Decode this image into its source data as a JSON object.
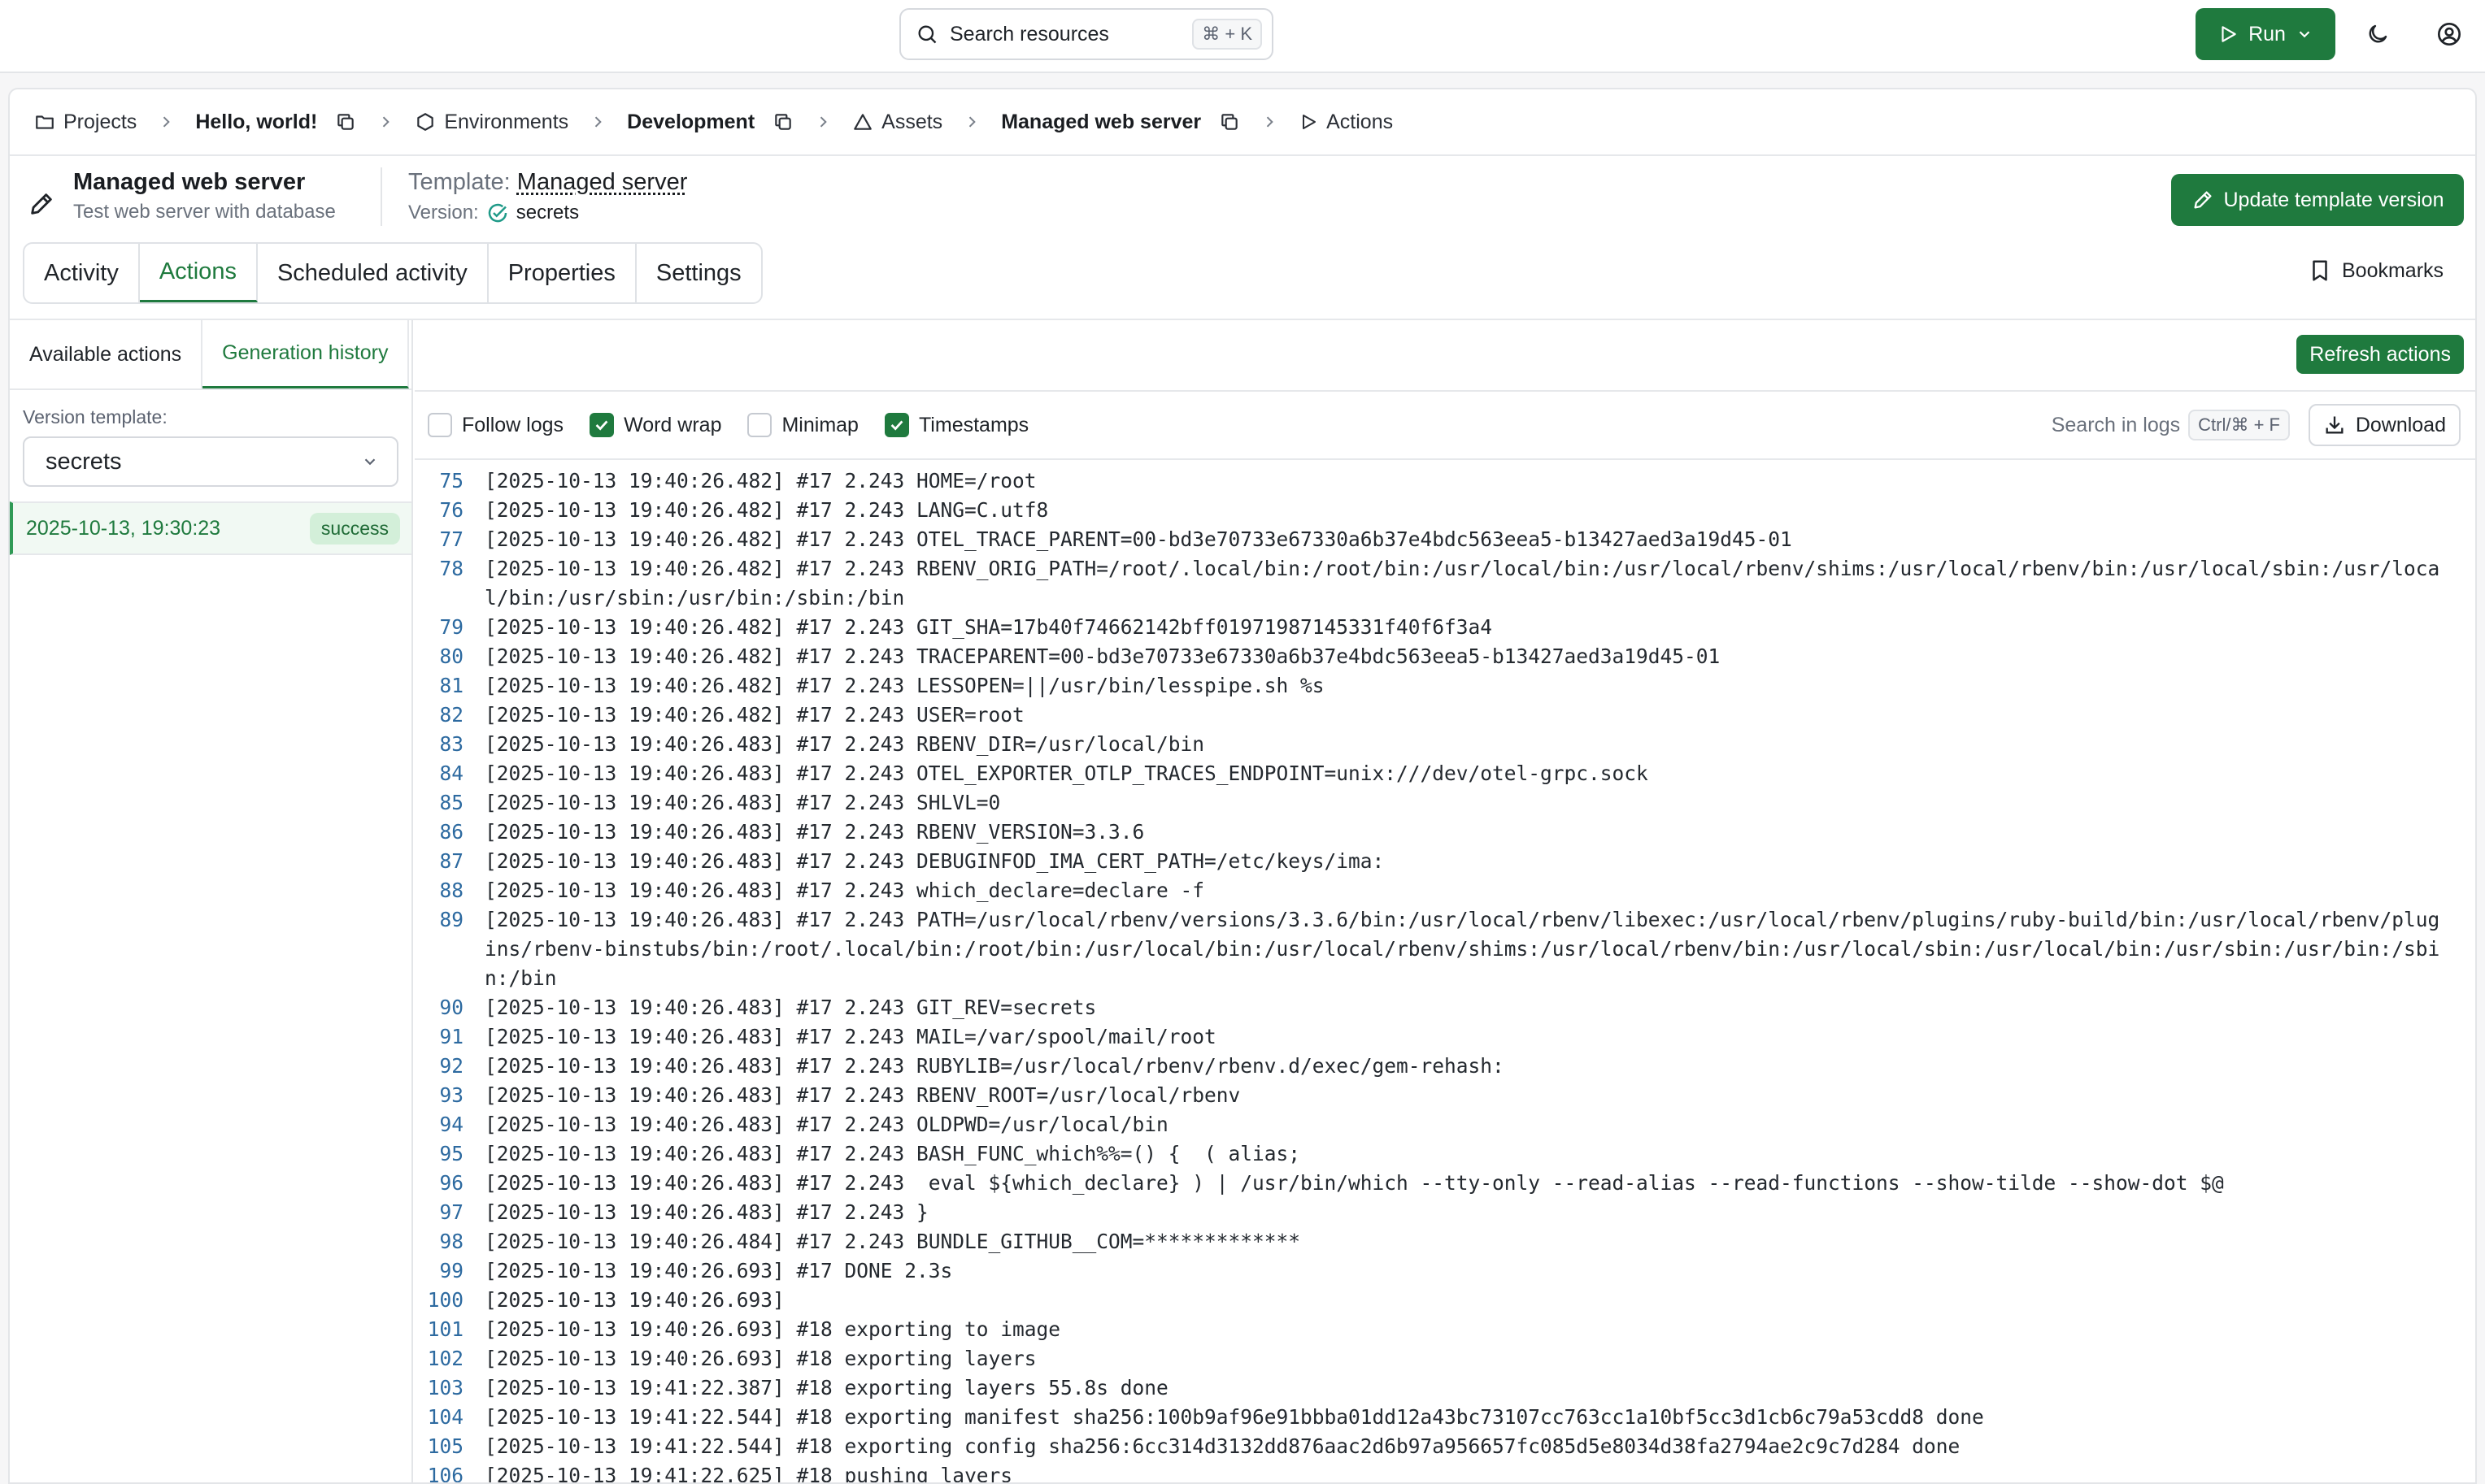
{
  "topbar": {
    "search_label": "Search resources",
    "search_shortcut": "⌘ + K",
    "run_label": "Run"
  },
  "breadcrumb": {
    "projects": "Projects",
    "project_name": "Hello, world!",
    "environments": "Environments",
    "environment_name": "Development",
    "assets": "Assets",
    "asset_name": "Managed web server",
    "actions": "Actions"
  },
  "header": {
    "title": "Managed web server",
    "subtitle": "Test web server with database",
    "template_prefix": "Template:",
    "template_name": "Managed server",
    "version_prefix": "Version:",
    "version_value": "secrets",
    "update_button": "Update template version"
  },
  "tabs": [
    "Activity",
    "Actions",
    "Scheduled activity",
    "Properties",
    "Settings"
  ],
  "active_tab": "Actions",
  "bookmarks_label": "Bookmarks",
  "sidebar": {
    "tabs": [
      "Available actions",
      "Generation history"
    ],
    "version_template_label": "Version template:",
    "selected_template": "secrets",
    "history": [
      {
        "date": "2025-10-13, 19:30:23",
        "status": "success"
      }
    ]
  },
  "toolbar": {
    "refresh_button": "Refresh actions",
    "follow_logs": "Follow logs",
    "word_wrap": "Word wrap",
    "minimap": "Minimap",
    "timestamps": "Timestamps",
    "search_in_logs": "Search in logs",
    "search_shortcut": "Ctrl/⌘ + F",
    "download": "Download"
  },
  "checkbox_states": {
    "follow_logs": false,
    "word_wrap": true,
    "minimap": false,
    "timestamps": true
  },
  "colors": {
    "accent": "#1f7a3e",
    "line_number": "#2d6aa0"
  },
  "log_lines": [
    {
      "n": "75",
      "t": "[2025-10-13 19:40:26.482] #17 2.243 HOME=/root"
    },
    {
      "n": "76",
      "t": "[2025-10-13 19:40:26.482] #17 2.243 LANG=C.utf8"
    },
    {
      "n": "77",
      "t": "[2025-10-13 19:40:26.482] #17 2.243 OTEL_TRACE_PARENT=00-bd3e70733e67330a6b37e4bdc563eea5-b13427aed3a19d45-01"
    },
    {
      "n": "78",
      "t": "[2025-10-13 19:40:26.482] #17 2.243 RBENV_ORIG_PATH=/root/.local/bin:/root/bin:/usr/local/bin:/usr/local/rbenv/shims:/usr/local/rbenv/bin:/usr/local/sbin:/usr/local/bin:/usr/sbin:/usr/bin:/sbin:/bin"
    },
    {
      "n": "79",
      "t": "[2025-10-13 19:40:26.482] #17 2.243 GIT_SHA=17b40f74662142bff01971987145331f40f6f3a4"
    },
    {
      "n": "80",
      "t": "[2025-10-13 19:40:26.482] #17 2.243 TRACEPARENT=00-bd3e70733e67330a6b37e4bdc563eea5-b13427aed3a19d45-01"
    },
    {
      "n": "81",
      "t": "[2025-10-13 19:40:26.482] #17 2.243 LESSOPEN=||/usr/bin/lesspipe.sh %s"
    },
    {
      "n": "82",
      "t": "[2025-10-13 19:40:26.482] #17 2.243 USER=root"
    },
    {
      "n": "83",
      "t": "[2025-10-13 19:40:26.483] #17 2.243 RBENV_DIR=/usr/local/bin"
    },
    {
      "n": "84",
      "t": "[2025-10-13 19:40:26.483] #17 2.243 OTEL_EXPORTER_OTLP_TRACES_ENDPOINT=unix:///dev/otel-grpc.sock"
    },
    {
      "n": "85",
      "t": "[2025-10-13 19:40:26.483] #17 2.243 SHLVL=0"
    },
    {
      "n": "86",
      "t": "[2025-10-13 19:40:26.483] #17 2.243 RBENV_VERSION=3.3.6"
    },
    {
      "n": "87",
      "t": "[2025-10-13 19:40:26.483] #17 2.243 DEBUGINFOD_IMA_CERT_PATH=/etc/keys/ima:"
    },
    {
      "n": "88",
      "t": "[2025-10-13 19:40:26.483] #17 2.243 which_declare=declare -f"
    },
    {
      "n": "89",
      "t": "[2025-10-13 19:40:26.483] #17 2.243 PATH=/usr/local/rbenv/versions/3.3.6/bin:/usr/local/rbenv/libexec:/usr/local/rbenv/plugins/ruby-build/bin:/usr/local/rbenv/plugins/rbenv-binstubs/bin:/root/.local/bin:/root/bin:/usr/local/bin:/usr/local/rbenv/shims:/usr/local/rbenv/bin:/usr/local/sbin:/usr/local/bin:/usr/sbin:/usr/bin:/sbin:/bin"
    },
    {
      "n": "90",
      "t": "[2025-10-13 19:40:26.483] #17 2.243 GIT_REV=secrets"
    },
    {
      "n": "91",
      "t": "[2025-10-13 19:40:26.483] #17 2.243 MAIL=/var/spool/mail/root"
    },
    {
      "n": "92",
      "t": "[2025-10-13 19:40:26.483] #17 2.243 RUBYLIB=/usr/local/rbenv/rbenv.d/exec/gem-rehash:"
    },
    {
      "n": "93",
      "t": "[2025-10-13 19:40:26.483] #17 2.243 RBENV_ROOT=/usr/local/rbenv"
    },
    {
      "n": "94",
      "t": "[2025-10-13 19:40:26.483] #17 2.243 OLDPWD=/usr/local/bin"
    },
    {
      "n": "95",
      "t": "[2025-10-13 19:40:26.483] #17 2.243 BASH_FUNC_which%%=() {  ( alias;"
    },
    {
      "n": "96",
      "t": "[2025-10-13 19:40:26.483] #17 2.243  eval ${which_declare} ) | /usr/bin/which --tty-only --read-alias --read-functions --show-tilde --show-dot $@"
    },
    {
      "n": "97",
      "t": "[2025-10-13 19:40:26.483] #17 2.243 }"
    },
    {
      "n": "98",
      "t": "[2025-10-13 19:40:26.484] #17 2.243 BUNDLE_GITHUB__COM=*************"
    },
    {
      "n": "99",
      "t": "[2025-10-13 19:40:26.693] #17 DONE 2.3s"
    },
    {
      "n": "100",
      "t": "[2025-10-13 19:40:26.693]"
    },
    {
      "n": "101",
      "t": "[2025-10-13 19:40:26.693] #18 exporting to image"
    },
    {
      "n": "102",
      "t": "[2025-10-13 19:40:26.693] #18 exporting layers"
    },
    {
      "n": "103",
      "t": "[2025-10-13 19:41:22.387] #18 exporting layers 55.8s done"
    },
    {
      "n": "104",
      "t": "[2025-10-13 19:41:22.544] #18 exporting manifest sha256:100b9af96e91bbba01dd12a43bc73107cc763cc1a10bf5cc3d1cb6c79a53cdd8 done"
    },
    {
      "n": "105",
      "t": "[2025-10-13 19:41:22.544] #18 exporting config sha256:6cc314d3132dd876aac2d6b97a956657fc085d5e8034d38fa2794ae2c9c7d284 done"
    },
    {
      "n": "106",
      "t": "[2025-10-13 19:41:22.625] #18 pushing layers"
    }
  ]
}
